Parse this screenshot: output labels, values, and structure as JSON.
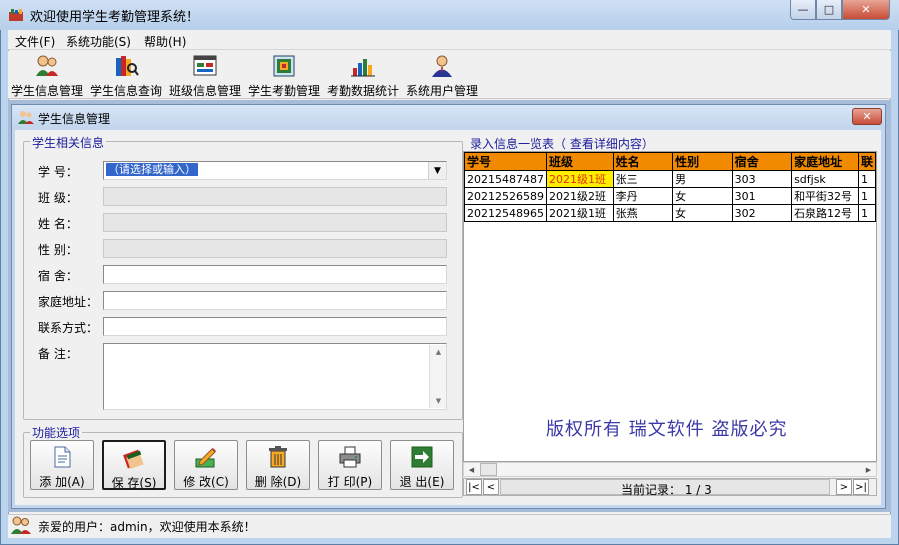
{
  "window": {
    "title": "欢迎使用学生考勤管理系统！",
    "minimize": "—",
    "maximize": "□",
    "close": "✕"
  },
  "menu": [
    "文件(F)",
    "系统功能(S)",
    "帮助(H)"
  ],
  "toolbar": [
    {
      "label": "学生信息管理",
      "icon": "people-icon"
    },
    {
      "label": "学生信息查询",
      "icon": "books-search-icon"
    },
    {
      "label": "班级信息管理",
      "icon": "class-board-icon"
    },
    {
      "label": "学生考勤管理",
      "icon": "attendance-board-icon"
    },
    {
      "label": "考勤数据统计",
      "icon": "bar-stats-icon"
    },
    {
      "label": "系统用户管理",
      "icon": "user-admin-icon"
    }
  ],
  "child": {
    "title": "学生信息管理",
    "close": "✕"
  },
  "form": {
    "legend": "学生相关信息",
    "fields": [
      {
        "label": "学    号：",
        "value": "（请选择或输入）"
      },
      {
        "label": "班    级：",
        "value": ""
      },
      {
        "label": "姓    名：",
        "value": ""
      },
      {
        "label": "性    别：",
        "value": ""
      },
      {
        "label": "宿    舍：",
        "value": ""
      },
      {
        "label": "家庭地址：",
        "value": ""
      },
      {
        "label": "联系方式：",
        "value": ""
      },
      {
        "label": "备    注：",
        "value": ""
      }
    ]
  },
  "functions": {
    "legend": "功能选项",
    "buttons": [
      {
        "label": "添 加(A)",
        "icon": "document-add-icon"
      },
      {
        "label": "保 存(S)",
        "icon": "save-book-icon"
      },
      {
        "label": "修 改(C)",
        "icon": "edit-pencil-icon"
      },
      {
        "label": "删 除(D)",
        "icon": "trash-icon"
      },
      {
        "label": "打 印(P)",
        "icon": "printer-icon"
      },
      {
        "label": "退 出(E)",
        "icon": "exit-arrow-icon"
      }
    ]
  },
  "list": {
    "legend": "录入信息一览表（    查看详细内容）",
    "columns": [
      "学号",
      "班级",
      "姓名",
      "性别",
      "宿舍",
      "家庭地址",
      "联"
    ],
    "rows": [
      [
        "20215487487",
        "2021级1班",
        "张三",
        "男",
        "303",
        "sdfjsk",
        "1"
      ],
      [
        "20212526589",
        "2021级2班",
        "李丹",
        "女",
        "301",
        "和平街32号",
        "1"
      ],
      [
        "20212548965",
        "2021级1班",
        "张燕",
        "女",
        "302",
        "石泉路12号",
        "1"
      ]
    ],
    "watermark": "版权所有  瑞文软件  盗版必究",
    "record_text": "当前记录：  1 / 3",
    "nav": [
      "|<",
      "<",
      ">",
      ">|"
    ]
  },
  "status": {
    "text": "亲爱的用户：admin，欢迎使用本系统！"
  }
}
